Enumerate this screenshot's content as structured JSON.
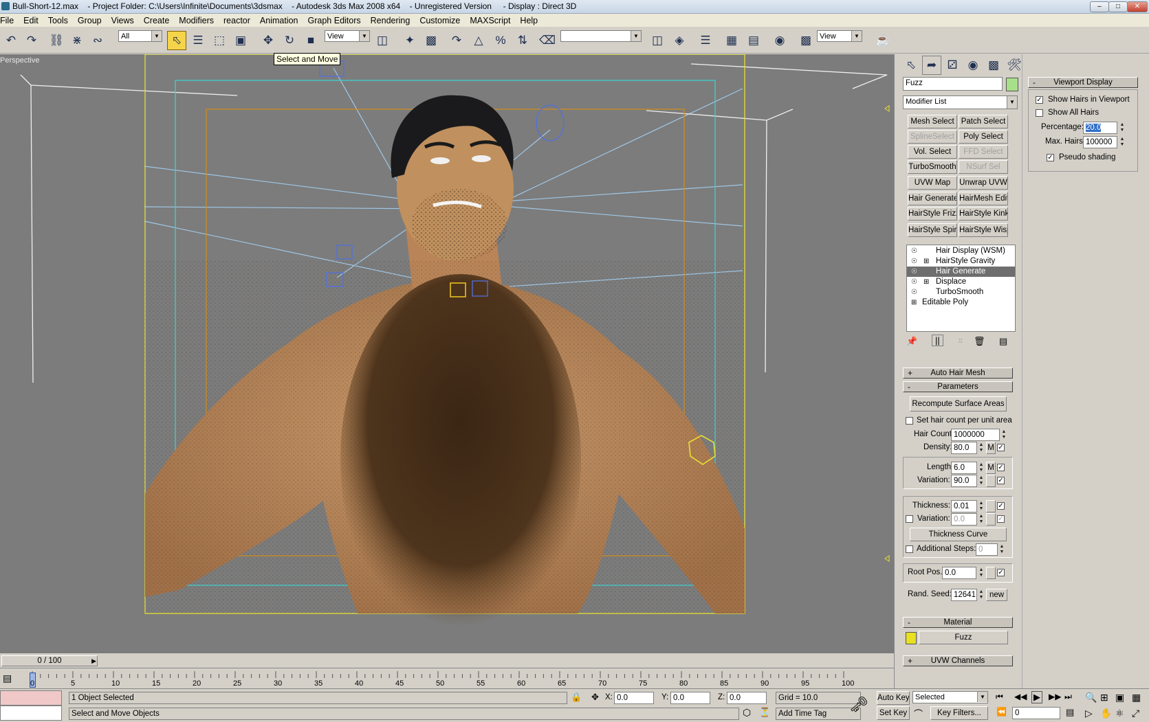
{
  "window": {
    "title": "Bull-Short-12.max    - Project Folder: C:\\Users\\Infinite\\Documents\\3dsmax    - Autodesk 3ds Max 2008 x64    - Unregistered Version     - Display : Direct 3D"
  },
  "menu": [
    "File",
    "Edit",
    "Tools",
    "Group",
    "Views",
    "Create",
    "Modifiers",
    "reactor",
    "Animation",
    "Graph Editors",
    "Rendering",
    "Customize",
    "MAXScript",
    "Help"
  ],
  "toolbar": {
    "selection_filter": "All",
    "ref_coord": "View",
    "named_selection": "",
    "view_dropdown": "View",
    "tooltip": "Select and Move"
  },
  "viewport": {
    "label": "Perspective"
  },
  "timeline": {
    "frame": "0 / 100",
    "ticks": [
      "0",
      "5",
      "10",
      "15",
      "20",
      "25",
      "30",
      "35",
      "40",
      "45",
      "50",
      "55",
      "60",
      "65",
      "70",
      "75",
      "80",
      "85",
      "90",
      "95",
      "100"
    ]
  },
  "status": {
    "selected": "1 Object Selected",
    "prompt": "Select and Move Objects",
    "x_label": "X:",
    "x": "0.0",
    "y_label": "Y:",
    "y": "0.0",
    "z_label": "Z:",
    "z": "0.0",
    "grid": "Grid = 10.0",
    "add_time_tag": "Add Time Tag",
    "auto_key": "Auto Key",
    "set_key": "Set Key",
    "key_mode": "Selected",
    "key_filters": "Key Filters...",
    "frame_field": "0"
  },
  "modify": {
    "object_name": "Fuzz",
    "object_color": "#a8e08a",
    "modifier_list": "Modifier List",
    "buttons": [
      {
        "label": "Mesh Select",
        "enabled": true
      },
      {
        "label": "Patch Select",
        "enabled": true
      },
      {
        "label": "SplineSelect",
        "enabled": false
      },
      {
        "label": "Poly Select",
        "enabled": true
      },
      {
        "label": "Vol. Select",
        "enabled": true
      },
      {
        "label": "FFD Select",
        "enabled": false
      },
      {
        "label": "TurboSmooth",
        "enabled": true
      },
      {
        "label": "NSurf Sel",
        "enabled": false
      },
      {
        "label": "UVW Map",
        "enabled": true
      },
      {
        "label": "Unwrap UVW",
        "enabled": true
      },
      {
        "label": "Hair Generate",
        "enabled": true
      },
      {
        "label": "HairMesh Edit",
        "enabled": true
      },
      {
        "label": "HairStyle Frizz",
        "enabled": true
      },
      {
        "label": "HairStyle Kink",
        "enabled": true
      },
      {
        "label": "HairStyle Spiral",
        "enabled": true
      },
      {
        "label": "HairStyle Wisps",
        "enabled": true
      }
    ],
    "stack": [
      {
        "label": "Hair Display (WSM)",
        "expand": false,
        "selected": false,
        "indent": true
      },
      {
        "label": "HairStyle Gravity",
        "expand": true,
        "selected": false,
        "indent": true
      },
      {
        "label": "Hair Generate",
        "expand": false,
        "selected": true,
        "indent": true
      },
      {
        "label": "Displace",
        "expand": true,
        "selected": false,
        "indent": true
      },
      {
        "label": "TurboSmooth",
        "expand": false,
        "selected": false,
        "indent": true
      },
      {
        "label": "Editable Poly",
        "expand": true,
        "selected": false,
        "indent": false
      }
    ]
  },
  "rollouts": {
    "auto_hair_mesh": "Auto Hair Mesh",
    "parameters": "Parameters",
    "recompute": "Recompute Surface Areas",
    "set_hair_count": "Set hair count per unit area",
    "hair_count_label": "Hair Count:",
    "hair_count": "1000000",
    "density_label": "Density:",
    "density": "80.0",
    "length_label": "Length:",
    "length": "6.0",
    "variation_label": "Variation:",
    "variation": "90.0",
    "thickness_label": "Thickness:",
    "thickness": "0.01",
    "thick_variation_label": "Variation:",
    "thick_variation": "0.0",
    "thickness_curve": "Thickness Curve",
    "additional_steps_label": "Additional Steps:",
    "additional_steps": "0",
    "root_pos_label": "Root Pos.:",
    "root_pos": "0.0",
    "rand_seed_label": "Rand. Seed:",
    "rand_seed": "12641",
    "new_button": "new",
    "m_label": "M",
    "material": "Material",
    "material_name": "Fuzz",
    "material_color": "#e8e020",
    "uvw_channels": "UVW Channels"
  },
  "viewport_display": {
    "title": "Viewport Display",
    "show_hairs": "Show Hairs in Viewport",
    "show_all": "Show All Hairs",
    "percentage_label": "Percentage:",
    "percentage": "20.0",
    "max_hairs_label": "Max. Hairs:",
    "max_hairs": "100000",
    "pseudo_shading": "Pseudo shading"
  }
}
